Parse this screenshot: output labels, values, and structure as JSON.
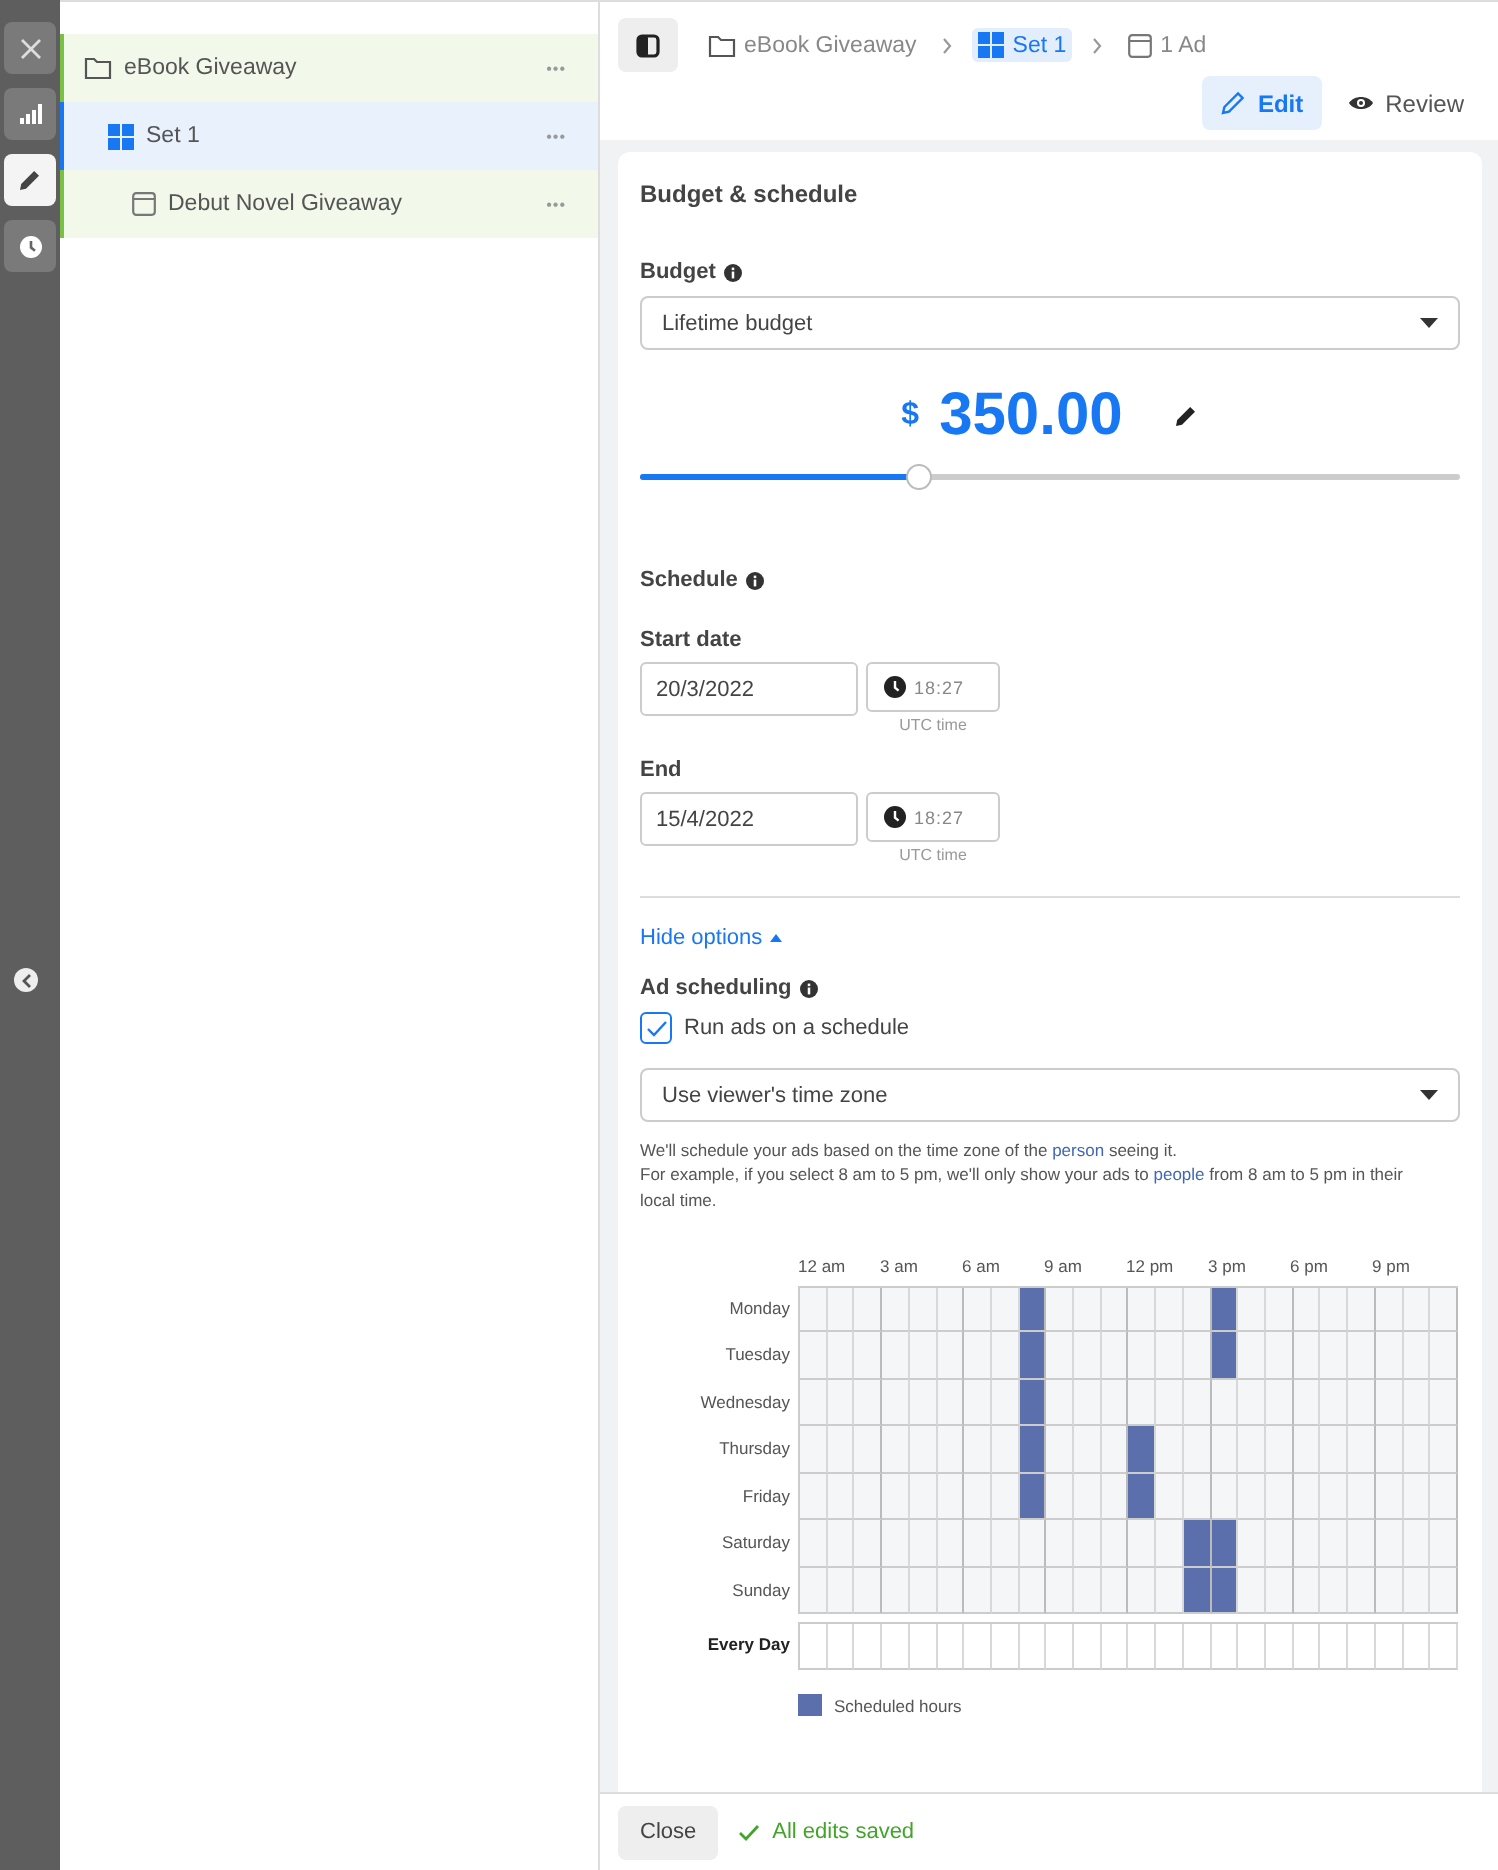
{
  "rail": {
    "buttons": [
      {
        "kind": "close",
        "selected": false
      },
      {
        "kind": "chart",
        "selected": false
      },
      {
        "kind": "edit",
        "selected": true
      },
      {
        "kind": "history",
        "selected": false
      }
    ]
  },
  "tree": {
    "items": [
      {
        "kind": "campaign",
        "label": "eBook Giveaway",
        "selected": false,
        "more": "•••"
      },
      {
        "kind": "set",
        "label": "Set 1",
        "selected": true,
        "more": "•••"
      },
      {
        "kind": "ad",
        "label": "Debut Novel Giveaway",
        "selected": false,
        "more": "•••"
      }
    ]
  },
  "breadcrumb": [
    {
      "kind": "campaign",
      "label": "eBook Giveaway",
      "selected": false
    },
    {
      "kind": "set",
      "label": "Set 1",
      "selected": true
    },
    {
      "kind": "ad",
      "label": "1 Ad",
      "selected": false
    }
  ],
  "mode_tabs": [
    {
      "kind": "edit",
      "label": "Edit",
      "selected": true
    },
    {
      "kind": "review",
      "label": "Review",
      "selected": false
    }
  ],
  "card": {
    "title": "Budget & schedule",
    "budget": {
      "label": "Budget",
      "type": "Lifetime budget",
      "currency": "$",
      "amount": "350.00",
      "level": 0.34
    },
    "schedule": {
      "label": "Schedule",
      "dates": [
        {
          "label": "Start date",
          "date": "20/3/2022",
          "time": "18:27",
          "note": "UTC time"
        },
        {
          "label": "End",
          "date": "15/4/2022",
          "time": "18:27",
          "note": "UTC time"
        }
      ]
    },
    "hide_options": "Hide options",
    "ad_scheduling": {
      "label": "Ad scheduling",
      "checkbox": {
        "label": "Run ads on a schedule",
        "checked": true
      },
      "time_zone": "Use viewer's time zone",
      "description": [
        [
          {
            "text": "We'll schedule your ads based on the time zone of the "
          },
          {
            "text": "person",
            "link": true
          },
          {
            "text": " seeing it."
          }
        ],
        [
          {
            "text": "For example, if you select 8 am to 5 pm, we'll only show your ads to "
          },
          {
            "text": "people",
            "link": true
          },
          {
            "text": " from 8 am to 5 pm in their local time."
          }
        ]
      ],
      "hours": [
        "12 am",
        "3 am",
        "6 am",
        "9 am",
        "12 pm",
        "3 pm",
        "6 pm",
        "9 pm"
      ],
      "days": [
        {
          "day": "Monday",
          "scheduled": [
            false,
            false,
            false,
            false,
            false,
            false,
            false,
            false,
            true,
            false,
            false,
            false,
            false,
            false,
            false,
            true,
            false,
            false,
            false,
            false,
            false,
            false,
            false,
            false
          ]
        },
        {
          "day": "Tuesday",
          "scheduled": [
            false,
            false,
            false,
            false,
            false,
            false,
            false,
            false,
            true,
            false,
            false,
            false,
            false,
            false,
            false,
            true,
            false,
            false,
            false,
            false,
            false,
            false,
            false,
            false
          ]
        },
        {
          "day": "Wednesday",
          "scheduled": [
            false,
            false,
            false,
            false,
            false,
            false,
            false,
            false,
            true,
            false,
            false,
            false,
            false,
            false,
            false,
            false,
            false,
            false,
            false,
            false,
            false,
            false,
            false,
            false
          ]
        },
        {
          "day": "Thursday",
          "scheduled": [
            false,
            false,
            false,
            false,
            false,
            false,
            false,
            false,
            true,
            false,
            false,
            false,
            true,
            false,
            false,
            false,
            false,
            false,
            false,
            false,
            false,
            false,
            false,
            false
          ]
        },
        {
          "day": "Friday",
          "scheduled": [
            false,
            false,
            false,
            false,
            false,
            false,
            false,
            false,
            true,
            false,
            false,
            false,
            true,
            false,
            false,
            false,
            false,
            false,
            false,
            false,
            false,
            false,
            false,
            false
          ]
        },
        {
          "day": "Saturday",
          "scheduled": [
            false,
            false,
            false,
            false,
            false,
            false,
            false,
            false,
            false,
            false,
            false,
            false,
            false,
            false,
            true,
            true,
            false,
            false,
            false,
            false,
            false,
            false,
            false,
            false
          ]
        },
        {
          "day": "Sunday",
          "scheduled": [
            false,
            false,
            false,
            false,
            false,
            false,
            false,
            false,
            false,
            false,
            false,
            false,
            false,
            false,
            true,
            true,
            false,
            false,
            false,
            false,
            false,
            false,
            false,
            false
          ]
        }
      ],
      "every_day": {
        "label": "Every Day",
        "scheduled": [
          false,
          false,
          false,
          false,
          false,
          false,
          false,
          false,
          false,
          false,
          false,
          false,
          false,
          false,
          false,
          false,
          false,
          false,
          false,
          false,
          false,
          false,
          false,
          false
        ]
      },
      "legend": "Scheduled hours"
    }
  },
  "footer": {
    "close": "Close",
    "status": "All edits saved"
  }
}
